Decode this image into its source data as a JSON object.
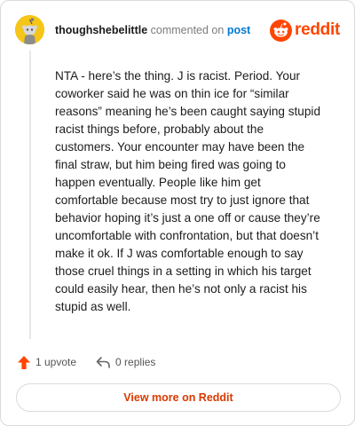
{
  "header": {
    "username": "thoughshebelittle",
    "action_text": "commented on",
    "post_link": "post"
  },
  "brand": {
    "wordmark": "reddit",
    "icon": "reddit-snoo-icon",
    "color": "#ff4500"
  },
  "comment": {
    "text": "NTA - here’s the thing. J is racist. Period. Your coworker said he was on thin ice for “similar reasons” meaning he’s been caught saying stupid racist things before, probably about the customers. Your encounter may have been the final straw, but him being fired was going to happen eventually. People like him get comfortable because most try to just ignore that behavior hoping it’s just a one off or cause they’re uncomfortable with confrontation, but that doesn’t make it ok. If J was comfortable enough to say those cruel things in a setting in which his target could easily hear, then he’s not only a racist his stupid as well."
  },
  "actions": {
    "upvote_label": "1 upvote",
    "upvote_icon": "upvote-arrow-icon",
    "replies_label": "0 replies",
    "replies_icon": "reply-arrow-icon"
  },
  "footer": {
    "view_more_label": "View more on Reddit"
  },
  "colors": {
    "accent": "#ff4500",
    "link": "#0079d3",
    "button_text": "#d93a00",
    "avatar_bg": "#f5c518"
  }
}
